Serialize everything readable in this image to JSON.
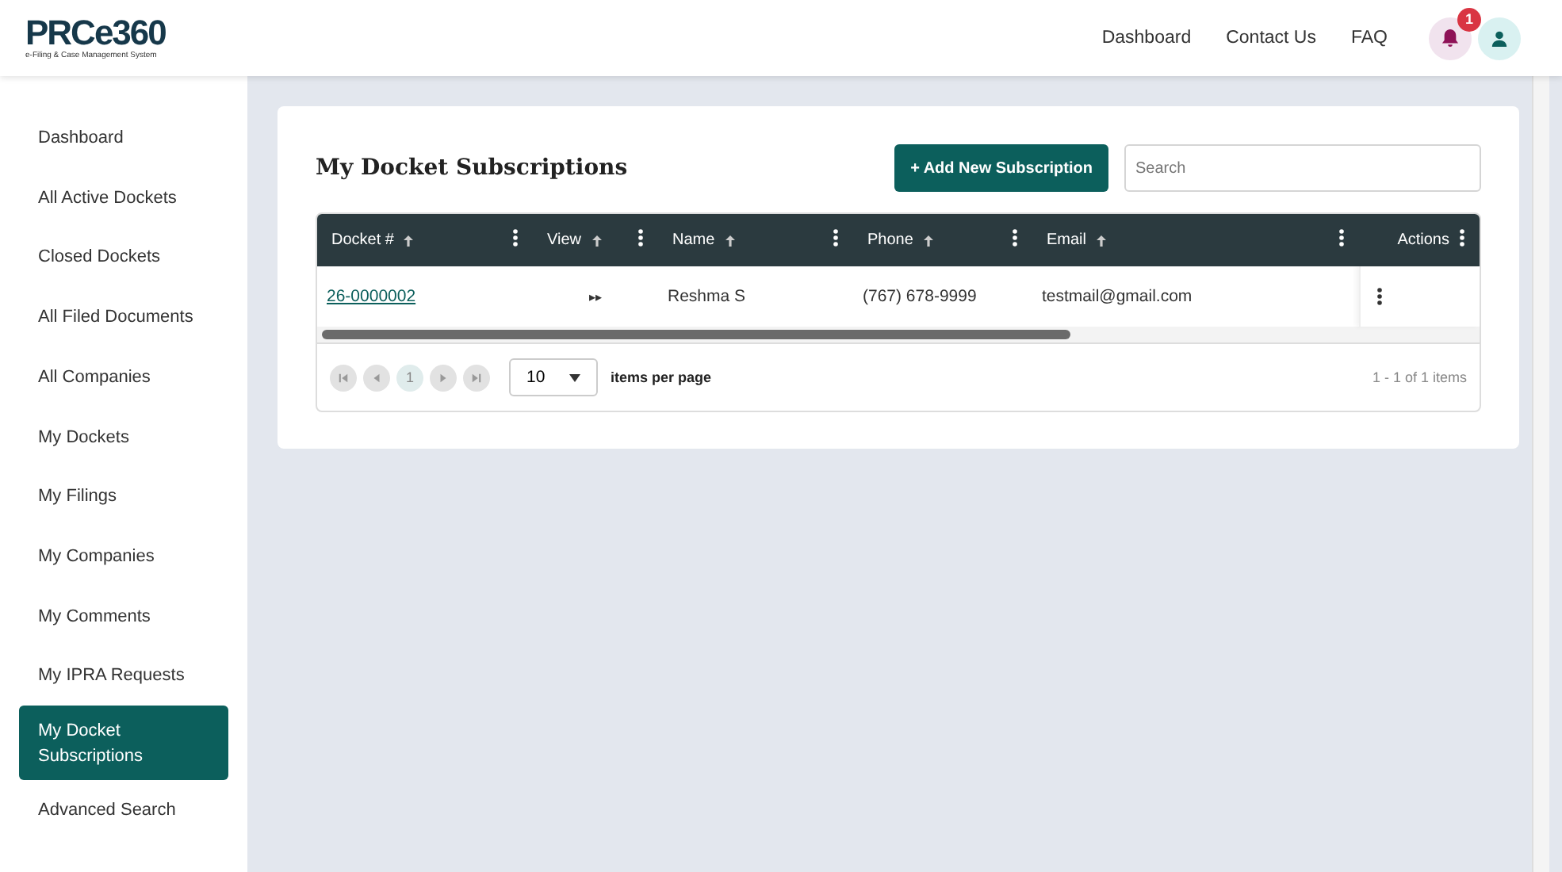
{
  "header": {
    "logo": {
      "name": "PRCe360",
      "tagline": "e-Filing & Case Management System"
    },
    "nav": [
      "Dashboard",
      "Contact Us",
      "FAQ"
    ],
    "notifications": {
      "count": "1"
    }
  },
  "sidebar": {
    "items": [
      {
        "label": "Dashboard",
        "selected": false
      },
      {
        "label": "All Active Dockets",
        "selected": false
      },
      {
        "label": "Closed Dockets",
        "selected": false
      },
      {
        "label": "All Filed Documents",
        "selected": false
      },
      {
        "label": "All Companies",
        "selected": false
      },
      {
        "label": "My Dockets",
        "selected": false
      },
      {
        "label": "My Filings",
        "selected": false
      },
      {
        "label": "My Companies",
        "selected": false
      },
      {
        "label": "My Comments",
        "selected": false
      },
      {
        "label": "My IPRA Requests",
        "selected": false
      },
      {
        "label": "My Docket Subscriptions",
        "selected": true
      },
      {
        "label": "Advanced Search",
        "selected": false
      }
    ]
  },
  "page": {
    "title": "My Docket Subscriptions",
    "add_button": "+ Add New Subscription",
    "search": {
      "placeholder": "Search"
    },
    "table": {
      "columns": [
        {
          "label": "Docket #",
          "sortable": true
        },
        {
          "label": "View",
          "sortable": true
        },
        {
          "label": "Name",
          "sortable": true
        },
        {
          "label": "Phone",
          "sortable": true
        },
        {
          "label": "Email",
          "sortable": true
        },
        {
          "label": "Actions",
          "sortable": false
        }
      ],
      "rows": [
        {
          "docket": "26-0000002",
          "view": "▸▸",
          "name": "Reshma S",
          "phone": "(767) 678-9999",
          "email": "testmail@gmail.com"
        }
      ]
    },
    "pager": {
      "page": "1",
      "page_size": "10",
      "page_size_label": "items per page",
      "summary": "1 - 1 of 1 items"
    }
  }
}
